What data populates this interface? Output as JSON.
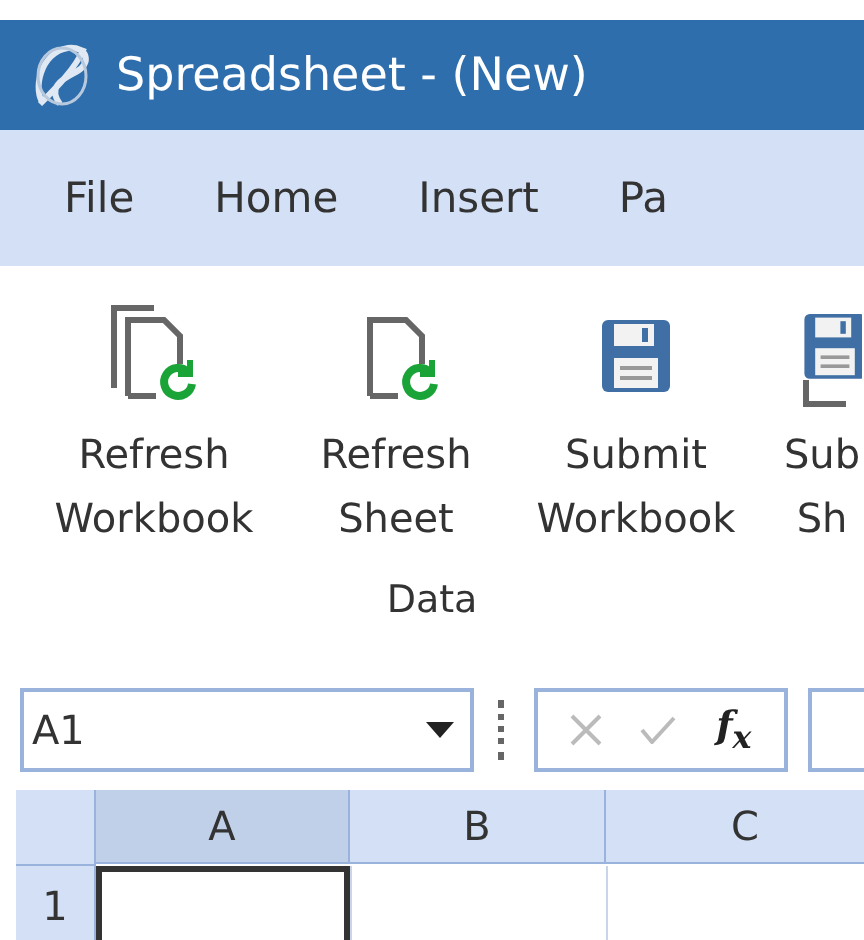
{
  "window": {
    "title": "Spreadsheet - (New)"
  },
  "menu": [
    {
      "label": "File"
    },
    {
      "label": "Home"
    },
    {
      "label": "Insert"
    },
    {
      "label": "Pa"
    }
  ],
  "ribbon": {
    "buttons": [
      {
        "kind": "refresh-workbook",
        "lines": [
          "Refresh",
          "Workbook"
        ]
      },
      {
        "kind": "refresh-sheet",
        "lines": [
          "Refresh",
          "Sheet"
        ]
      },
      {
        "kind": "submit-workbook",
        "lines": [
          "Submit",
          "Workbook"
        ]
      },
      {
        "kind": "submit-sheet",
        "lines": [
          "Sub",
          "Sh"
        ]
      }
    ],
    "group_label": "Data"
  },
  "formula_bar": {
    "name_box": "A1",
    "function_label": "f$_{x}$"
  },
  "grid": {
    "columns": [
      {
        "label": "A",
        "selected": true
      },
      {
        "label": "B",
        "selected": false
      },
      {
        "label": "C",
        "selected": false
      }
    ],
    "rows": [
      {
        "label": "1",
        "cells": [
          {
            "selected": true
          },
          {
            "selected": false
          },
          {
            "selected": false
          }
        ]
      }
    ]
  }
}
